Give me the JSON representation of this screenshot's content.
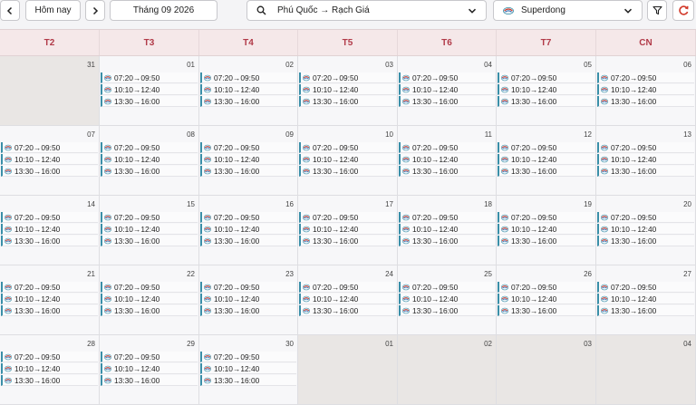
{
  "toolbar": {
    "prev_icon": "chevron-left-icon",
    "today_label": "Hôm nay",
    "next_icon": "chevron-right-icon",
    "month_label": "Tháng 09 2026",
    "route_value": "Phú Quốc → Rạch Giá",
    "operator_value": "Superdong",
    "filter_icon": "filter-icon",
    "refresh_icon": "refresh-icon"
  },
  "weekdays": [
    "T2",
    "T3",
    "T4",
    "T5",
    "T6",
    "T7",
    "CN"
  ],
  "colors": {
    "header_text": "#b13a48",
    "header_bg": "#f5e8e9",
    "trip_accent": "#3a8fa8",
    "out_month_bg": "#e9e6e4",
    "refresh": "#d23a2a"
  },
  "weeks": [
    [
      {
        "day": "31",
        "in_month": false,
        "trips": []
      },
      {
        "day": "01",
        "in_month": true,
        "trips": [
          "07:20→09:50",
          "10:10→12:40",
          "13:30→16:00"
        ]
      },
      {
        "day": "02",
        "in_month": true,
        "trips": [
          "07:20→09:50",
          "10:10→12:40",
          "13:30→16:00"
        ]
      },
      {
        "day": "03",
        "in_month": true,
        "trips": [
          "07:20→09:50",
          "10:10→12:40",
          "13:30→16:00"
        ]
      },
      {
        "day": "04",
        "in_month": true,
        "trips": [
          "07:20→09:50",
          "10:10→12:40",
          "13:30→16:00"
        ]
      },
      {
        "day": "05",
        "in_month": true,
        "trips": [
          "07:20→09:50",
          "10:10→12:40",
          "13:30→16:00"
        ]
      },
      {
        "day": "06",
        "in_month": true,
        "trips": [
          "07:20→09:50",
          "10:10→12:40",
          "13:30→16:00"
        ]
      }
    ],
    [
      {
        "day": "07",
        "in_month": true,
        "trips": [
          "07:20→09:50",
          "10:10→12:40",
          "13:30→16:00"
        ]
      },
      {
        "day": "08",
        "in_month": true,
        "trips": [
          "07:20→09:50",
          "10:10→12:40",
          "13:30→16:00"
        ]
      },
      {
        "day": "09",
        "in_month": true,
        "trips": [
          "07:20→09:50",
          "10:10→12:40",
          "13:30→16:00"
        ]
      },
      {
        "day": "10",
        "in_month": true,
        "trips": [
          "07:20→09:50",
          "10:10→12:40",
          "13:30→16:00"
        ]
      },
      {
        "day": "11",
        "in_month": true,
        "trips": [
          "07:20→09:50",
          "10:10→12:40",
          "13:30→16:00"
        ]
      },
      {
        "day": "12",
        "in_month": true,
        "trips": [
          "07:20→09:50",
          "10:10→12:40",
          "13:30→16:00"
        ]
      },
      {
        "day": "13",
        "in_month": true,
        "trips": [
          "07:20→09:50",
          "10:10→12:40",
          "13:30→16:00"
        ]
      }
    ],
    [
      {
        "day": "14",
        "in_month": true,
        "trips": [
          "07:20→09:50",
          "10:10→12:40",
          "13:30→16:00"
        ]
      },
      {
        "day": "15",
        "in_month": true,
        "trips": [
          "07:20→09:50",
          "10:10→12:40",
          "13:30→16:00"
        ]
      },
      {
        "day": "16",
        "in_month": true,
        "trips": [
          "07:20→09:50",
          "10:10→12:40",
          "13:30→16:00"
        ]
      },
      {
        "day": "17",
        "in_month": true,
        "trips": [
          "07:20→09:50",
          "10:10→12:40",
          "13:30→16:00"
        ]
      },
      {
        "day": "18",
        "in_month": true,
        "trips": [
          "07:20→09:50",
          "10:10→12:40",
          "13:30→16:00"
        ]
      },
      {
        "day": "19",
        "in_month": true,
        "trips": [
          "07:20→09:50",
          "10:10→12:40",
          "13:30→16:00"
        ]
      },
      {
        "day": "20",
        "in_month": true,
        "trips": [
          "07:20→09:50",
          "10:10→12:40",
          "13:30→16:00"
        ]
      }
    ],
    [
      {
        "day": "21",
        "in_month": true,
        "trips": [
          "07:20→09:50",
          "10:10→12:40",
          "13:30→16:00"
        ]
      },
      {
        "day": "22",
        "in_month": true,
        "trips": [
          "07:20→09:50",
          "10:10→12:40",
          "13:30→16:00"
        ]
      },
      {
        "day": "23",
        "in_month": true,
        "trips": [
          "07:20→09:50",
          "10:10→12:40",
          "13:30→16:00"
        ]
      },
      {
        "day": "24",
        "in_month": true,
        "trips": [
          "07:20→09:50",
          "10:10→12:40",
          "13:30→16:00"
        ]
      },
      {
        "day": "25",
        "in_month": true,
        "trips": [
          "07:20→09:50",
          "10:10→12:40",
          "13:30→16:00"
        ]
      },
      {
        "day": "26",
        "in_month": true,
        "trips": [
          "07:20→09:50",
          "10:10→12:40",
          "13:30→16:00"
        ]
      },
      {
        "day": "27",
        "in_month": true,
        "trips": [
          "07:20→09:50",
          "10:10→12:40",
          "13:30→16:00"
        ]
      }
    ],
    [
      {
        "day": "28",
        "in_month": true,
        "trips": [
          "07:20→09:50",
          "10:10→12:40",
          "13:30→16:00"
        ]
      },
      {
        "day": "29",
        "in_month": true,
        "trips": [
          "07:20→09:50",
          "10:10→12:40",
          "13:30→16:00"
        ]
      },
      {
        "day": "30",
        "in_month": true,
        "trips": [
          "07:20→09:50",
          "10:10→12:40",
          "13:30→16:00"
        ]
      },
      {
        "day": "01",
        "in_month": false,
        "trips": []
      },
      {
        "day": "02",
        "in_month": false,
        "trips": []
      },
      {
        "day": "03",
        "in_month": false,
        "trips": []
      },
      {
        "day": "04",
        "in_month": false,
        "trips": []
      }
    ]
  ]
}
